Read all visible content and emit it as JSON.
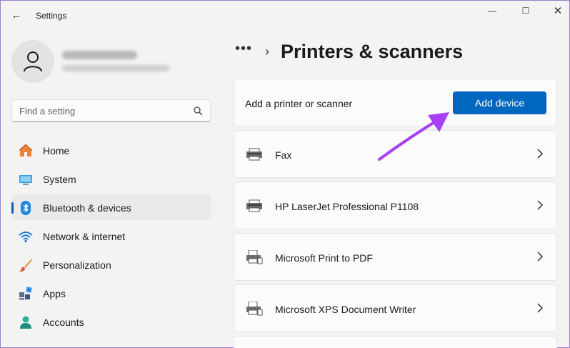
{
  "window": {
    "title": "Settings",
    "back_glyph": "←",
    "minimize_glyph": "—",
    "maximize_glyph": "☐",
    "close_glyph": "✕"
  },
  "search": {
    "placeholder": "Find a setting"
  },
  "sidebar": {
    "items": [
      {
        "label": "Home",
        "icon": "home-icon",
        "selected": false
      },
      {
        "label": "System",
        "icon": "system-icon",
        "selected": false
      },
      {
        "label": "Bluetooth & devices",
        "icon": "bluetooth-icon",
        "selected": true
      },
      {
        "label": "Network & internet",
        "icon": "wifi-icon",
        "selected": false
      },
      {
        "label": "Personalization",
        "icon": "brush-icon",
        "selected": false
      },
      {
        "label": "Apps",
        "icon": "apps-icon",
        "selected": false
      },
      {
        "label": "Accounts",
        "icon": "accounts-icon",
        "selected": false
      }
    ]
  },
  "breadcrumb": {
    "more": "•••",
    "chevron": "›",
    "title": "Printers & scanners"
  },
  "add_device": {
    "label": "Add a printer or scanner",
    "button": "Add device"
  },
  "devices": [
    {
      "name": "Fax",
      "icon": "fax-icon"
    },
    {
      "name": "HP LaserJet Professional P1108",
      "icon": "printer-icon"
    },
    {
      "name": "Microsoft Print to PDF",
      "icon": "printer-icon"
    },
    {
      "name": "Microsoft XPS Document Writer",
      "icon": "printer-icon"
    }
  ],
  "colors": {
    "accent": "#0067c0",
    "annotation_arrow": "#a740f5"
  }
}
